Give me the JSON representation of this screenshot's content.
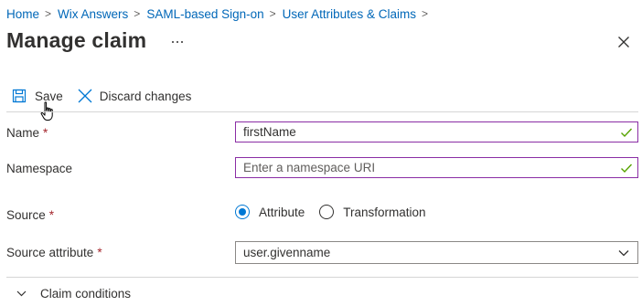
{
  "breadcrumb": {
    "items": [
      "Home",
      "Wix Answers",
      "SAML-based Sign-on",
      "User Attributes & Claims"
    ],
    "separator": ">"
  },
  "page": {
    "title": "Manage claim",
    "more_label": "...",
    "close_label": "Close"
  },
  "toolbar": {
    "save_label": "Save",
    "discard_label": "Discard changes"
  },
  "form": {
    "name": {
      "label": "Name",
      "required_mark": "*",
      "value": "firstName",
      "valid": true
    },
    "namespace": {
      "label": "Namespace",
      "value": "",
      "placeholder": "Enter a namespace URI",
      "valid": true
    },
    "source": {
      "label": "Source",
      "required_mark": "*",
      "options": [
        "Attribute",
        "Transformation"
      ],
      "selected": "Attribute"
    },
    "source_attribute": {
      "label": "Source attribute",
      "required_mark": "*",
      "value": "user.givenname"
    }
  },
  "claim_conditions": {
    "label": "Claim conditions",
    "expanded": false
  },
  "colors": {
    "link": "#0067b8",
    "accent": "#0078d4",
    "focus_border": "#8a2da5",
    "valid_check": "#57a300",
    "required": "#a4262c"
  },
  "icons": {
    "save": "save-icon",
    "discard": "close-icon",
    "more": "more-icon",
    "close": "close-icon",
    "valid": "checkmark-icon",
    "dropdown": "chevron-down-icon",
    "expander": "chevron-down-icon"
  }
}
